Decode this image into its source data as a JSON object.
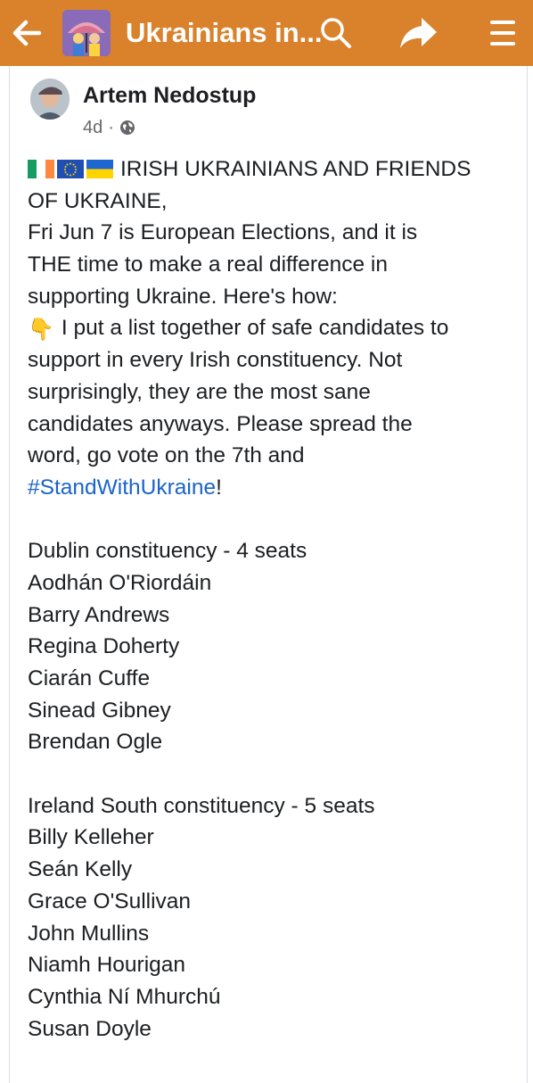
{
  "header": {
    "title": "Ukrainians in...",
    "back_icon": "arrow-left-icon",
    "search_icon": "search-icon",
    "share_icon": "share-icon",
    "menu_icon": "hamburger-menu-icon",
    "bar_color": "#d9822b"
  },
  "post": {
    "author": "Artem Nedostup",
    "time": "4d",
    "separator": "·",
    "privacy_icon": "globe-icon",
    "flags": [
      "ireland-flag",
      "eu-flag",
      "ukraine-flag"
    ],
    "intro_line1": "IRISH UKRAINIANS AND FRIENDS",
    "intro_line2": "OF UKRAINE,",
    "para": [
      "Fri Jun 7 is European Elections, and it is",
      "THE time to make a real difference in",
      "supporting Ukraine. Here's how:"
    ],
    "pointer_emoji": "👇",
    "list_para": [
      "I put a list together of safe candidates to",
      "support in every Irish constituency. Not",
      "surprisingly, they are the most sane",
      "candidates anyways. Please spread the",
      "word, go vote on the 7th and"
    ],
    "hashtag": "#StandWithUkraine",
    "hashtag_suffix": "!",
    "dublin": {
      "heading": "Dublin constituency - 4 seats",
      "candidates": [
        "Aodhán O'Riordáin",
        "Barry Andrews",
        "Regina Doherty",
        "Ciarán Cuffe",
        "Sinead Gibney",
        "Brendan Ogle"
      ]
    },
    "south": {
      "heading": "Ireland South constituency - 5 seats",
      "candidates": [
        "Billy Kelleher",
        "Seán Kelly",
        "Grace O'Sullivan",
        "John Mullins",
        "Niamh Hourigan",
        "Cynthia Ní Mhurchú",
        "Susan Doyle"
      ]
    }
  }
}
